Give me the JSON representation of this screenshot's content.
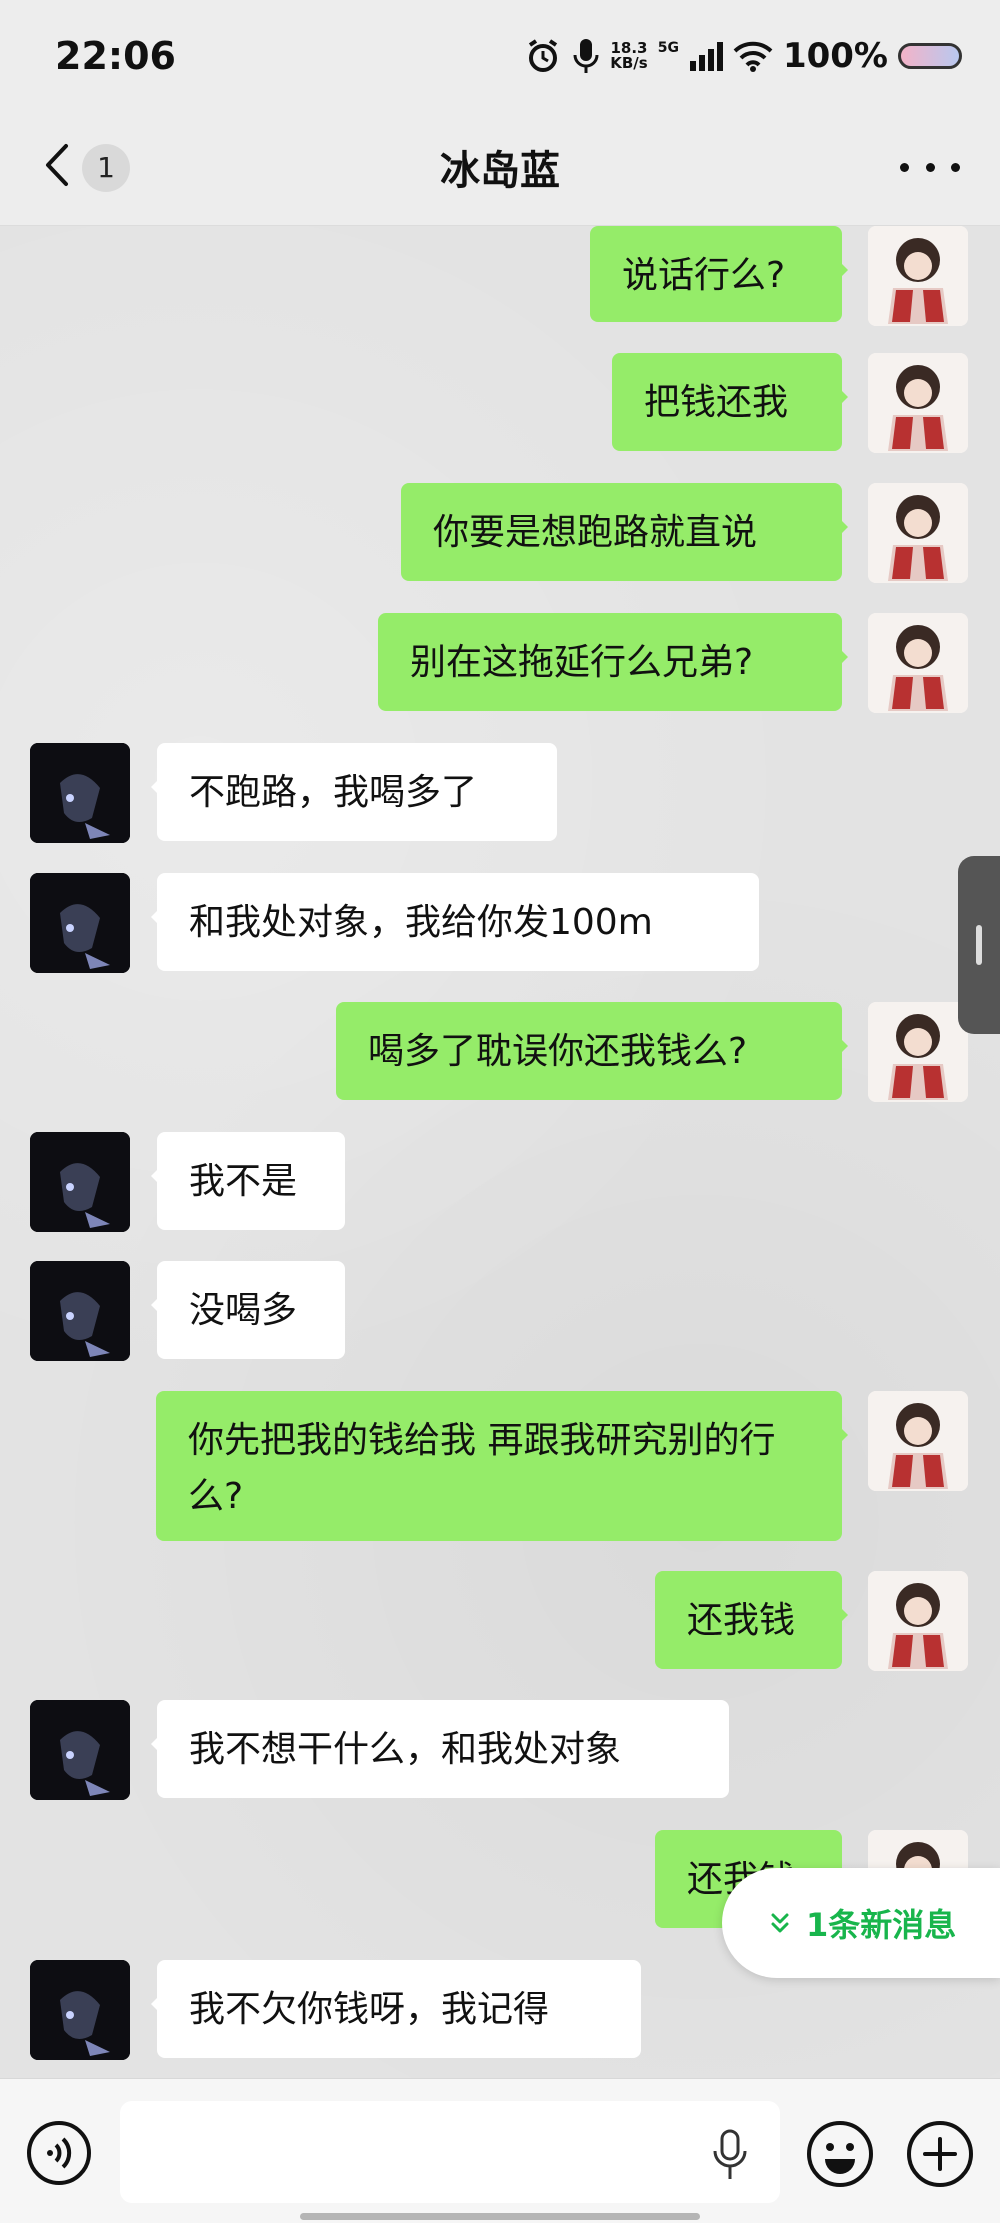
{
  "status_bar": {
    "time": "22:06",
    "net_speed_value": "18.3",
    "net_speed_unit": "KB/s",
    "network": "5G",
    "battery": "100%",
    "icons": [
      "alarm-icon",
      "mic-icon",
      "signal-icon",
      "wifi-icon",
      "battery-icon"
    ]
  },
  "header": {
    "unread_count": "1",
    "title": "冰岛蓝"
  },
  "messages": [
    {
      "side": "me",
      "text": "说话行么?"
    },
    {
      "side": "me",
      "text": "把钱还我"
    },
    {
      "side": "me",
      "text": "你要是想跑路就直说"
    },
    {
      "side": "me",
      "text": "别在这拖延行么兄弟?"
    },
    {
      "side": "them",
      "text": "不跑路，我喝多了"
    },
    {
      "side": "them",
      "text": "和我处对象，我给你发100m"
    },
    {
      "side": "me",
      "text": "喝多了耽误你还我钱么?"
    },
    {
      "side": "them",
      "text": "我不是"
    },
    {
      "side": "them",
      "text": "没喝多"
    },
    {
      "side": "me",
      "text": "你先把我的钱给我 再跟我研究别的行么?"
    },
    {
      "side": "me",
      "text": "还我钱"
    },
    {
      "side": "them",
      "text": "我不想干什么，和我处对象"
    },
    {
      "side": "me",
      "text": "还我钱"
    },
    {
      "side": "them",
      "text": "我不欠你钱呀，我记得"
    }
  ],
  "new_message_notice": "1条新消息",
  "colors": {
    "me_bubble": "#95ec69",
    "them_bubble": "#ffffff",
    "accent": "#18b54c"
  }
}
